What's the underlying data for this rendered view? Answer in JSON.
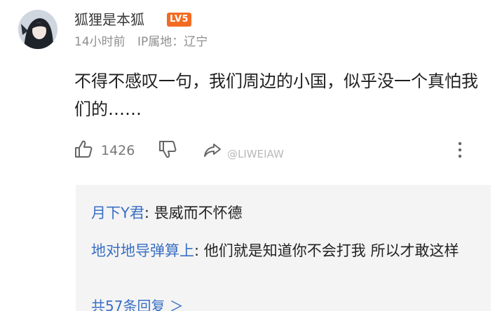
{
  "comment": {
    "username": "狐狸是本狐",
    "level_badge": "LV5",
    "time": "14小时前",
    "ip_location": "IP属地：辽宁",
    "text": "不得不感叹一句，我们周边的小国，似乎没一个真怕我们的……",
    "like_count": "1426",
    "watermark": "@LIWEIAW"
  },
  "icons": {
    "like": "thumbs-up-icon",
    "dislike": "thumbs-down-icon",
    "share": "share-icon",
    "more": "more-vertical-icon"
  },
  "replies": [
    {
      "author": "月下Y君",
      "separator": ": ",
      "text": "畏威而不怀德"
    },
    {
      "author": "地对地导弹算上",
      "separator": ": ",
      "text": "他们就是知道你不会打我 所以才敢这样"
    }
  ],
  "more_replies_label": "共57条回复 ＞",
  "colors": {
    "accent_link": "#3a6fc4",
    "badge": "#f36b22",
    "reply_background": "#f4f4f4",
    "meta_text": "#8e8e8e"
  }
}
